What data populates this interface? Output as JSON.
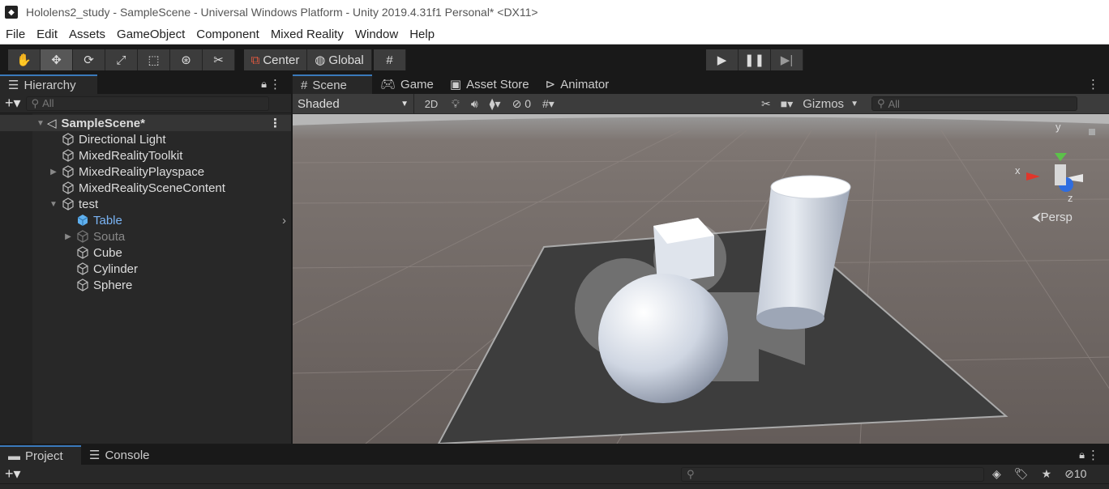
{
  "window": {
    "title": "Hololens2_study - SampleScene - Universal Windows Platform - Unity 2019.4.31f1 Personal* <DX11>"
  },
  "menu": [
    "File",
    "Edit",
    "Assets",
    "GameObject",
    "Component",
    "Mixed Reality",
    "Window",
    "Help"
  ],
  "toolbar": {
    "pivot_label": "Center",
    "space_label": "Global"
  },
  "hierarchy": {
    "tab_label": "Hierarchy",
    "search_placeholder": "All",
    "scene_name": "SampleScene*",
    "items": [
      {
        "label": "Directional Light"
      },
      {
        "label": "MixedRealityToolkit"
      },
      {
        "label": "MixedRealityPlayspace"
      },
      {
        "label": "MixedRealitySceneContent"
      },
      {
        "label": "test"
      },
      {
        "label": "Table"
      },
      {
        "label": "Souta"
      },
      {
        "label": "Cube"
      },
      {
        "label": "Cylinder"
      },
      {
        "label": "Sphere"
      }
    ]
  },
  "scene_tabs": [
    {
      "label": "Scene"
    },
    {
      "label": "Game"
    },
    {
      "label": "Asset Store"
    },
    {
      "label": "Animator"
    }
  ],
  "scene_toolbar": {
    "shading": "Shaded",
    "mode_2d": "2D",
    "hidden_count": "0",
    "gizmos": "Gizmos",
    "search_placeholder": "All"
  },
  "gizmo": {
    "y": "y",
    "x": "x",
    "z": "z",
    "persp": "Persp"
  },
  "bottom": {
    "tabs": [
      {
        "label": "Project"
      },
      {
        "label": "Console"
      }
    ],
    "hidden_count": "10"
  },
  "colors": {
    "accent": "#3a79bb",
    "selected_text": "#7ab4f5",
    "panel": "#282828"
  }
}
